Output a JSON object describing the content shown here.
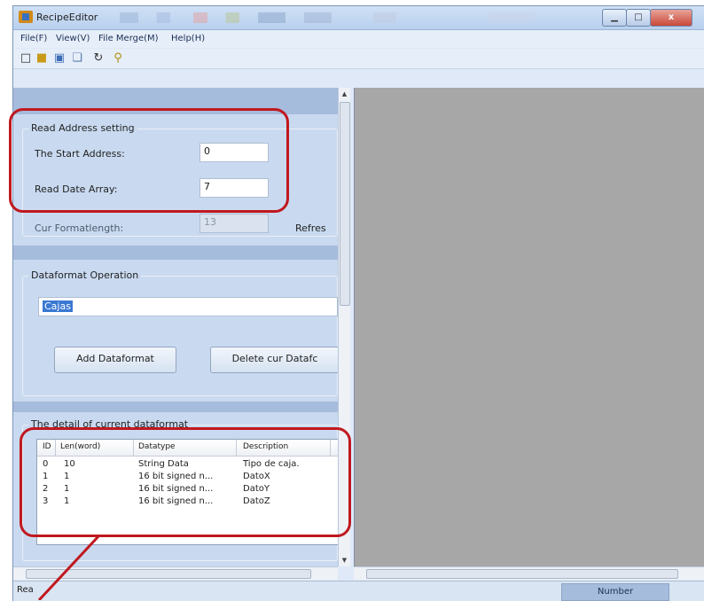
{
  "window": {
    "title": "RecipeEditor",
    "buttons": {
      "minimize": "▁",
      "maximize": "□",
      "close": "x"
    }
  },
  "menu": [
    "File(F)",
    "View(V)",
    "File Merge(M)",
    "Help(H)"
  ],
  "toolbar": [
    "new-icon",
    "open-icon",
    "save-icon",
    "copy-icon",
    "refresh-icon",
    "help-icon"
  ],
  "read_address": {
    "title": "Read Address setting",
    "start_label": "The Start Address:",
    "start_value": "0",
    "array_label": "Read Date Array:",
    "array_value": "7",
    "cur_label": "Cur Formatlength:",
    "cur_value": "13",
    "refresh": "Refres"
  },
  "dataformat": {
    "title": "Dataformat Operation",
    "selected": "Cajas",
    "add_button": "Add Dataformat",
    "delete_button": "Delete cur Datafc"
  },
  "detail": {
    "title": "The detail of current dataformat",
    "columns": [
      "ID",
      "Len(word)",
      "Datatype",
      "Description"
    ],
    "rows": [
      [
        "0",
        "10",
        "String Data",
        "Tipo de caja."
      ],
      [
        "1",
        "1",
        "16 bit signed n...",
        "DatoX"
      ],
      [
        "2",
        "1",
        "16 bit signed n...",
        "DatoY"
      ],
      [
        "3",
        "1",
        "16 bit signed n...",
        "DatoZ"
      ]
    ]
  },
  "status": {
    "left": "Rea",
    "right": "Number"
  },
  "colors": {
    "highlight": "#c0181f",
    "band": "#a6bcdc",
    "canvas": "#a7a7a7"
  }
}
